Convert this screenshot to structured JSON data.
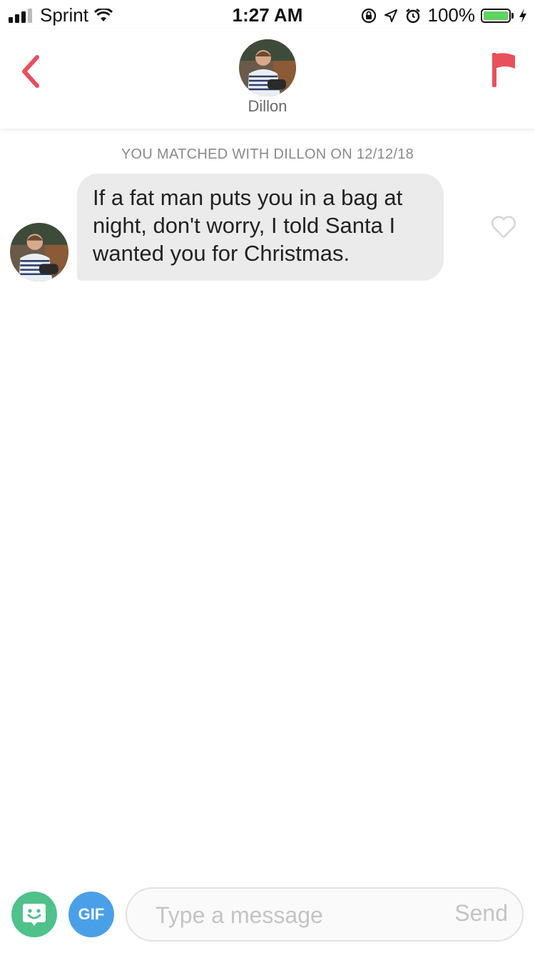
{
  "status_bar": {
    "carrier": "Sprint",
    "time": "1:27 AM",
    "battery_percent": "100%",
    "battery_level": 1.0,
    "icons": [
      "signal-icon",
      "wifi-icon",
      "rotation-lock-icon",
      "location-icon",
      "alarm-icon",
      "battery-icon",
      "charging-icon"
    ]
  },
  "header": {
    "name": "Dillon",
    "back_icon": "chevron-left-icon",
    "report_icon": "flag-icon"
  },
  "chat": {
    "match_notice": "YOU MATCHED WITH DILLON ON 12/12/18",
    "messages": [
      {
        "sender": "Dillon",
        "lines": [
          "If a fat man puts you in a bag at",
          "night, don't worry, I told Santa I",
          "wanted you for Christmas."
        ],
        "liked": false
      }
    ]
  },
  "composer": {
    "sticker_icon": "sticker-face-icon",
    "gif_label": "GIF",
    "placeholder": "Type a message",
    "value": "",
    "send_label": "Send"
  },
  "colors": {
    "accent": "#e8505b",
    "bubble_bg": "#ebebeb",
    "sticker_green": "#4fc18b",
    "gif_blue": "#4aa0e8",
    "battery_green": "#5fd35f"
  }
}
